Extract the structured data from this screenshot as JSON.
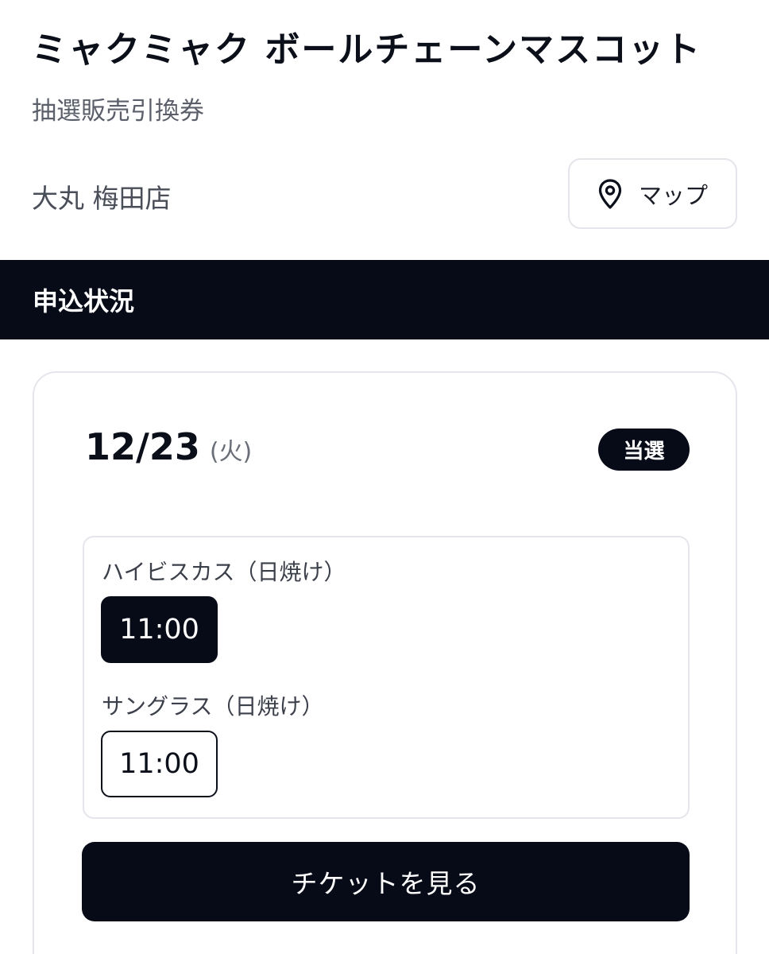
{
  "product": {
    "title": "ミャクミャク ボールチェーンマスコット",
    "subtitle": "抽選販売引換券"
  },
  "store": {
    "name": "大丸 梅田店",
    "map_button_label": "マップ",
    "map_icon": "map-pin-icon"
  },
  "section": {
    "title": "申込状況"
  },
  "entry": {
    "date": "12/23",
    "weekday": "(火)",
    "status": "当選",
    "items": [
      {
        "name": "ハイビスカス（日焼け）",
        "time": "11:00",
        "selected": true
      },
      {
        "name": "サングラス（日焼け）",
        "time": "11:00",
        "selected": false
      }
    ],
    "ticket_button_label": "チケットを見る"
  },
  "colors": {
    "primary_dark": "#060b17",
    "text_muted": "#5b5f6a",
    "border": "#e4e6ec",
    "background": "#ffffff"
  }
}
